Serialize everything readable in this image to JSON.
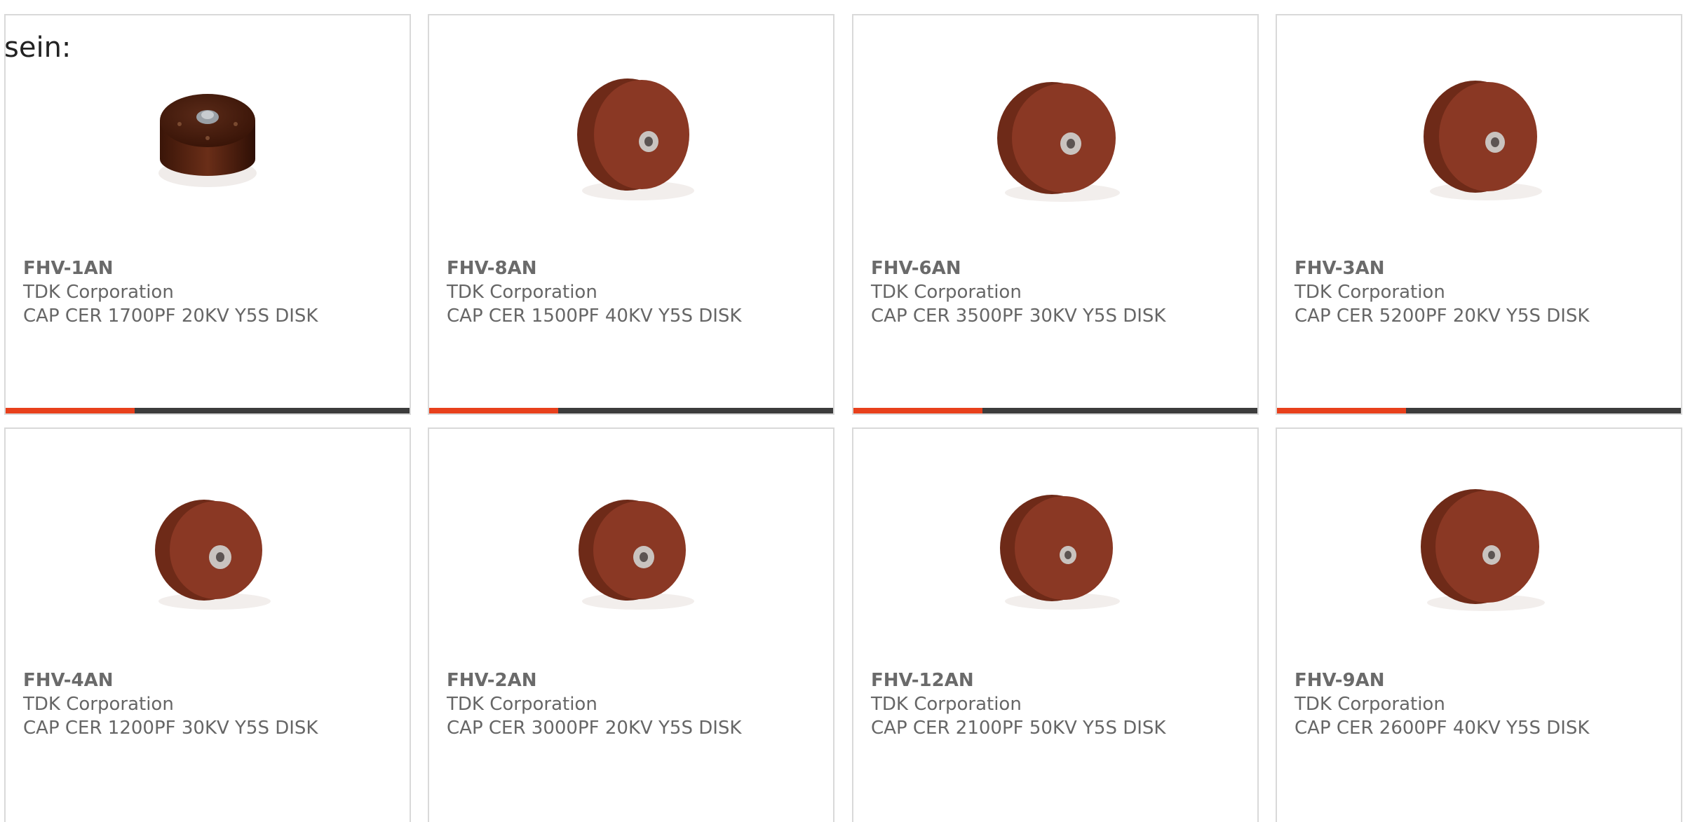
{
  "lead_text": "sein:",
  "colors": {
    "accent": "#e8401c",
    "bar_track": "#3c3c3c",
    "capacitor_body": "#7a3020",
    "text": "#666666"
  },
  "products": [
    {
      "part_number": "FHV-1AN",
      "manufacturer": "TDK Corporation",
      "description": "CAP CER 1700PF 20KV Y5S DISK",
      "image_icon": "capacitor-dark-top-icon",
      "progress": 0.32
    },
    {
      "part_number": "FHV-8AN",
      "manufacturer": "TDK Corporation",
      "description": "CAP CER 1500PF 40KV Y5S DISK",
      "image_icon": "capacitor-disk-icon",
      "progress": 0.32
    },
    {
      "part_number": "FHV-6AN",
      "manufacturer": "TDK Corporation",
      "description": "CAP CER 3500PF 30KV Y5S DISK",
      "image_icon": "capacitor-disk-icon",
      "progress": 0.32
    },
    {
      "part_number": "FHV-3AN",
      "manufacturer": "TDK Corporation",
      "description": "CAP CER 5200PF 20KV Y5S DISK",
      "image_icon": "capacitor-disk-icon",
      "progress": 0.32
    },
    {
      "part_number": "FHV-4AN",
      "manufacturer": "TDK Corporation",
      "description": "CAP CER 1200PF 30KV Y5S DISK",
      "image_icon": "capacitor-disk-icon"
    },
    {
      "part_number": "FHV-2AN",
      "manufacturer": "TDK Corporation",
      "description": "CAP CER 3000PF 20KV Y5S DISK",
      "image_icon": "capacitor-disk-icon"
    },
    {
      "part_number": "FHV-12AN",
      "manufacturer": "TDK Corporation",
      "description": "CAP CER 2100PF 50KV Y5S DISK",
      "image_icon": "capacitor-disk-icon"
    },
    {
      "part_number": "FHV-9AN",
      "manufacturer": "TDK Corporation",
      "description": "CAP CER 2600PF 40KV Y5S DISK",
      "image_icon": "capacitor-disk-icon"
    }
  ]
}
